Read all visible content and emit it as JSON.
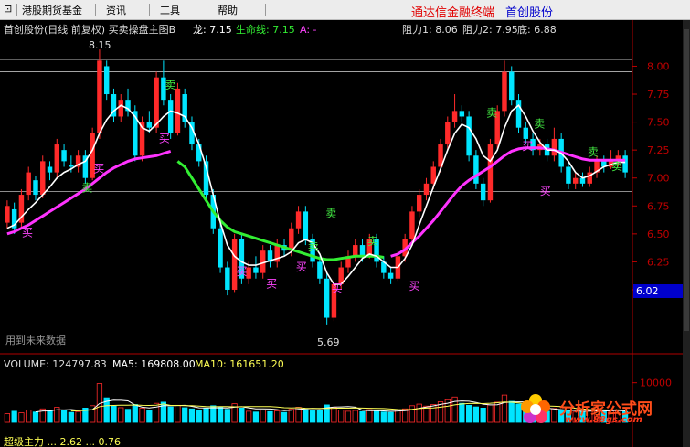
{
  "menu": {
    "items": [
      "港股期货基金",
      "资讯",
      "工具",
      "帮助"
    ],
    "app_title": "通达信金融终端",
    "stock_name": "首创股份"
  },
  "chart_header": {
    "title": "首创股份(日线 前复权) 买卖操盘主图B",
    "dragon_label": "龙: 7.15",
    "lifeline_label": "生命线: 7.15",
    "a_label": "A: -",
    "resistance1": "阻力1: 8.06",
    "resistance2": "阻力2: 7.95",
    "bottom": "底: 6.88"
  },
  "volume_header": {
    "volume": "VOLUME: 124797.83",
    "ma5": "MA5: 169808.00",
    "ma10": "MA10: 161651.20"
  },
  "notes": {
    "future_data": "用到未来数据",
    "peak_label": "8.15",
    "trough_label": "5.69",
    "current_price": "6.02",
    "bottom_row_partial": "超级主力 ... 2.62 ... 0.76"
  },
  "colors": {
    "up": "#ff2a2a",
    "down": "#00e5ff",
    "ma_white": "#ffffff",
    "ma_green": "#33ee33",
    "ma_magenta": "#ff33ff",
    "axis": "#c00000",
    "buy_label": "#ff44ff",
    "sell_label": "#44ee44"
  },
  "chart_data": {
    "type": "candlestick",
    "title": "首创股份(日线 前复权)",
    "ylim": [
      5.55,
      8.2
    ],
    "y_ticks": [
      8.0,
      7.75,
      7.5,
      7.25,
      7.0,
      6.75,
      6.5,
      6.25,
      6.0
    ],
    "resistance_lines": [
      8.06,
      7.95,
      6.88
    ],
    "candles": [
      [
        6.6,
        6.75,
        6.8,
        6.55
      ],
      [
        6.72,
        6.55,
        6.78,
        6.5
      ],
      [
        6.6,
        6.85,
        6.9,
        6.55
      ],
      [
        6.85,
        7.05,
        7.1,
        6.8
      ],
      [
        6.98,
        6.85,
        7.02,
        6.8
      ],
      [
        6.85,
        7.15,
        7.2,
        6.82
      ],
      [
        7.1,
        7.05,
        7.15,
        6.98
      ],
      [
        7.05,
        7.3,
        7.35,
        7.0
      ],
      [
        7.25,
        7.15,
        7.3,
        7.1
      ],
      [
        7.12,
        7.1,
        7.2,
        7.05
      ],
      [
        7.1,
        7.2,
        7.25,
        7.05
      ],
      [
        7.2,
        7.0,
        7.25,
        6.95
      ],
      [
        7.0,
        7.4,
        7.45,
        6.98
      ],
      [
        7.4,
        8.05,
        8.15,
        7.35
      ],
      [
        8.0,
        7.75,
        8.05,
        7.7
      ],
      [
        7.75,
        7.55,
        7.8,
        7.5
      ],
      [
        7.55,
        7.7,
        7.75,
        7.5
      ],
      [
        7.7,
        7.6,
        7.8,
        7.55
      ],
      [
        7.6,
        7.2,
        7.65,
        7.15
      ],
      [
        7.2,
        7.5,
        7.55,
        7.15
      ],
      [
        7.5,
        7.45,
        7.6,
        7.4
      ],
      [
        7.45,
        7.9,
        7.95,
        7.4
      ],
      [
        7.9,
        7.7,
        8.05,
        7.65
      ],
      [
        7.7,
        7.4,
        7.75,
        7.35
      ],
      [
        7.4,
        7.8,
        7.85,
        7.38
      ],
      [
        7.75,
        7.5,
        7.8,
        7.45
      ],
      [
        7.5,
        7.3,
        7.55,
        7.25
      ],
      [
        7.3,
        7.15,
        7.35,
        7.1
      ],
      [
        7.15,
        6.85,
        7.2,
        6.8
      ],
      [
        6.85,
        6.55,
        6.9,
        6.5
      ],
      [
        6.55,
        6.2,
        6.6,
        6.15
      ],
      [
        6.2,
        6.0,
        6.25,
        5.95
      ],
      [
        6.0,
        6.45,
        6.5,
        5.98
      ],
      [
        6.45,
        6.1,
        6.5,
        6.05
      ],
      [
        6.1,
        6.2,
        6.25,
        6.05
      ],
      [
        6.2,
        6.15,
        6.3,
        6.1
      ],
      [
        6.15,
        6.35,
        6.4,
        6.1
      ],
      [
        6.35,
        6.25,
        6.4,
        6.2
      ],
      [
        6.25,
        6.4,
        6.45,
        6.2
      ],
      [
        6.4,
        6.35,
        6.45,
        6.3
      ],
      [
        6.35,
        6.55,
        6.6,
        6.3
      ],
      [
        6.55,
        6.7,
        6.75,
        6.5
      ],
      [
        6.7,
        6.45,
        6.75,
        6.4
      ],
      [
        6.45,
        6.25,
        6.5,
        6.2
      ],
      [
        6.25,
        6.1,
        6.3,
        6.05
      ],
      [
        6.1,
        5.75,
        6.15,
        5.69
      ],
      [
        5.75,
        6.05,
        6.1,
        5.72
      ],
      [
        6.05,
        6.2,
        6.25,
        6.0
      ],
      [
        6.2,
        6.3,
        6.35,
        6.15
      ],
      [
        6.3,
        6.4,
        6.45,
        6.25
      ],
      [
        6.4,
        6.3,
        6.45,
        6.25
      ],
      [
        6.3,
        6.45,
        6.5,
        6.28
      ],
      [
        6.45,
        6.25,
        6.5,
        6.2
      ],
      [
        6.25,
        6.15,
        6.3,
        6.1
      ],
      [
        6.15,
        6.1,
        6.2,
        6.05
      ],
      [
        6.1,
        6.3,
        6.35,
        6.08
      ],
      [
        6.3,
        6.45,
        6.5,
        6.25
      ],
      [
        6.45,
        6.7,
        6.75,
        6.4
      ],
      [
        6.7,
        6.85,
        6.9,
        6.65
      ],
      [
        6.85,
        6.95,
        7.0,
        6.8
      ],
      [
        6.95,
        7.1,
        7.15,
        6.9
      ],
      [
        7.1,
        7.3,
        7.35,
        7.05
      ],
      [
        7.3,
        7.5,
        7.55,
        7.25
      ],
      [
        7.5,
        7.6,
        7.75,
        7.45
      ],
      [
        7.6,
        7.55,
        7.65,
        7.5
      ],
      [
        7.55,
        7.2,
        7.6,
        7.15
      ],
      [
        7.2,
        6.95,
        7.25,
        6.9
      ],
      [
        6.95,
        6.8,
        7.0,
        6.75
      ],
      [
        6.8,
        7.3,
        7.35,
        6.78
      ],
      [
        7.3,
        7.6,
        7.65,
        7.25
      ],
      [
        7.6,
        7.95,
        8.05,
        7.55
      ],
      [
        7.95,
        7.7,
        8.0,
        7.65
      ],
      [
        7.7,
        7.45,
        7.75,
        7.4
      ],
      [
        7.45,
        7.35,
        7.5,
        7.3
      ],
      [
        7.35,
        7.25,
        7.4,
        7.2
      ],
      [
        7.25,
        7.3,
        7.35,
        7.2
      ],
      [
        7.3,
        7.2,
        7.35,
        7.15
      ],
      [
        7.2,
        7.35,
        7.45,
        7.15
      ],
      [
        7.35,
        7.1,
        7.4,
        7.05
      ],
      [
        7.1,
        6.95,
        7.15,
        6.9
      ],
      [
        6.95,
        7.0,
        7.05,
        6.9
      ],
      [
        7.0,
        6.95,
        7.05,
        6.92
      ],
      [
        6.95,
        7.05,
        7.1,
        6.92
      ],
      [
        7.05,
        7.15,
        7.2,
        7.0
      ],
      [
        7.15,
        7.1,
        7.2,
        7.05
      ],
      [
        7.1,
        7.15,
        7.25,
        7.08
      ],
      [
        7.15,
        7.2,
        7.25,
        7.1
      ],
      [
        7.2,
        7.05,
        7.25,
        7.0
      ]
    ],
    "ma_white": [
      6.55,
      6.58,
      6.65,
      6.72,
      6.78,
      6.85,
      6.92,
      7.0,
      7.05,
      7.08,
      7.12,
      7.15,
      7.25,
      7.4,
      7.52,
      7.6,
      7.65,
      7.62,
      7.55,
      7.45,
      7.42,
      7.48,
      7.55,
      7.6,
      7.58,
      7.55,
      7.45,
      7.3,
      7.1,
      6.85,
      6.6,
      6.4,
      6.3,
      6.25,
      6.22,
      6.22,
      6.24,
      6.26,
      6.28,
      6.3,
      6.34,
      6.42,
      6.45,
      6.42,
      6.32,
      6.15,
      6.05,
      6.05,
      6.12,
      6.2,
      6.28,
      6.32,
      6.3,
      6.25,
      6.2,
      6.2,
      6.28,
      6.4,
      6.58,
      6.75,
      6.92,
      7.08,
      7.25,
      7.4,
      7.48,
      7.45,
      7.35,
      7.2,
      7.15,
      7.25,
      7.45,
      7.6,
      7.65,
      7.55,
      7.42,
      7.32,
      7.25,
      7.25,
      7.22,
      7.15,
      7.05,
      7.0,
      7.02,
      7.06,
      7.1,
      7.12,
      7.14,
      7.14
    ],
    "ma_green": [
      null,
      null,
      null,
      null,
      null,
      null,
      null,
      null,
      null,
      null,
      null,
      null,
      null,
      null,
      null,
      null,
      null,
      null,
      null,
      null,
      null,
      null,
      null,
      null,
      7.15,
      7.1,
      7.0,
      6.9,
      6.8,
      6.7,
      6.62,
      6.56,
      6.52,
      6.5,
      6.48,
      6.46,
      6.44,
      6.42,
      6.4,
      6.38,
      6.36,
      6.34,
      6.32,
      6.3,
      6.28,
      6.27,
      6.27,
      6.28,
      6.29,
      6.3,
      6.3,
      6.3,
      6.3,
      6.29
    ],
    "ma_magenta": [
      6.5,
      6.52,
      6.55,
      6.58,
      6.62,
      6.66,
      6.7,
      6.74,
      6.78,
      6.82,
      6.86,
      6.9,
      6.95,
      7.0,
      7.05,
      7.09,
      7.12,
      7.15,
      7.17,
      7.18,
      7.19,
      7.2,
      7.22,
      7.24,
      null,
      null,
      null,
      null,
      null,
      null,
      null,
      null,
      null,
      null,
      null,
      null,
      null,
      null,
      null,
      null,
      null,
      null,
      null,
      null,
      null,
      null,
      null,
      null,
      null,
      null,
      null,
      null,
      null,
      null,
      6.3,
      6.32,
      6.36,
      6.42,
      6.48,
      6.55,
      6.62,
      6.7,
      6.78,
      6.86,
      6.93,
      6.98,
      7.02,
      7.06,
      7.1,
      7.15,
      7.2,
      7.24,
      7.26,
      7.27,
      7.27,
      7.27,
      7.26,
      7.25,
      7.23,
      7.21,
      7.19,
      7.17,
      7.16,
      7.16,
      7.16,
      7.16,
      7.16,
      7.16
    ],
    "buy_marks": [
      [
        4,
        6.48
      ],
      [
        16,
        7.05
      ],
      [
        27,
        7.32
      ],
      [
        40,
        6.13
      ],
      [
        45,
        6.02
      ],
      [
        50,
        6.17
      ],
      [
        56,
        5.98
      ],
      [
        69,
        6.0
      ],
      [
        88,
        7.25
      ],
      [
        91,
        6.85
      ]
    ],
    "sell_marks": [
      [
        14,
        6.88
      ],
      [
        28,
        7.8
      ],
      [
        52,
        6.35
      ],
      [
        55,
        6.65
      ],
      [
        62,
        6.4
      ],
      [
        82,
        7.55
      ],
      [
        90,
        7.45
      ],
      [
        99,
        7.2
      ],
      [
        103,
        7.07
      ]
    ],
    "volume": {
      "ylim": [
        0,
        12000
      ],
      "y_ticks": [
        10000
      ],
      "values": [
        2200,
        2800,
        2400,
        3100,
        2600,
        3400,
        2900,
        3800,
        3000,
        2500,
        2700,
        3600,
        4200,
        9800,
        6200,
        4100,
        3700,
        3300,
        4500,
        3600,
        3100,
        4800,
        5100,
        3900,
        4300,
        3700,
        3400,
        3100,
        3600,
        4200,
        3900,
        3300,
        4700,
        3600,
        2800,
        2600,
        3100,
        2700,
        2900,
        2500,
        3300,
        3800,
        3200,
        2900,
        3000,
        4400,
        3800,
        3100,
        2800,
        3000,
        2700,
        3200,
        2900,
        2600,
        2500,
        3100,
        3400,
        4200,
        4600,
        4100,
        4500,
        5200,
        5700,
        6400,
        4800,
        4300,
        3900,
        3600,
        4400,
        5100,
        6900,
        5300,
        4600,
        3900,
        3400,
        3200,
        2800,
        3500,
        3100,
        2900,
        2600,
        2700,
        2900,
        3300,
        2800,
        2900,
        3000,
        2700
      ],
      "ma5": [
        null,
        null,
        null,
        null,
        2620,
        2860,
        2880,
        3160,
        3140,
        3240,
        3040,
        3120,
        3200,
        4760,
        5300,
        5580,
        5560,
        5420,
        4360,
        3840,
        3640,
        3860,
        4220,
        4200,
        4240,
        4300,
        4040,
        3680,
        3620,
        3660,
        3660,
        3620,
        3840,
        3940,
        3660,
        3400,
        3400,
        3360,
        3200,
        2960,
        3040,
        3280,
        3420,
        3540,
        3440,
        3660,
        3860,
        3900,
        3980,
        3820,
        3080,
        2960,
        2920,
        2880,
        2780,
        2860,
        2940,
        3160,
        3560,
        3880,
        4160,
        4520,
        4820,
        5280,
        5400,
        5320,
        5020,
        4600,
        4400,
        4460,
        4980,
        5120,
        5160,
        5160,
        4820,
        4180,
        3580,
        3360,
        3200,
        3060,
        2980,
        2760,
        2820,
        2880,
        2860,
        2920,
        3000,
        2880
      ],
      "ma10": [
        null,
        null,
        null,
        null,
        null,
        null,
        null,
        null,
        null,
        2870,
        2900,
        3000,
        3180,
        3960,
        4220,
        4260,
        4340,
        4310,
        4390,
        4300,
        4280,
        4340,
        4640,
        4280,
        4270,
        4230,
        4200,
        4080,
        3960,
        3940,
        3990,
        3980,
        3930,
        3950,
        3980,
        3960,
        3980,
        3960,
        3880,
        3700,
        3620,
        3690,
        3560,
        3520,
        3540,
        3540,
        3560,
        3590,
        3580,
        3640,
        3610,
        3550,
        3520,
        3490,
        3360,
        3230,
        3190,
        3300,
        3480,
        3590,
        3630,
        3830,
        4060,
        4400,
        4630,
        4750,
        4800,
        4740,
        4820,
        4960,
        5150,
        5070,
        4900,
        4670,
        4470,
        4250,
        4140,
        4060,
        3980,
        3800,
        3550,
        3360,
        3230,
        3180,
        3130,
        3110,
        3130,
        3090
      ]
    }
  }
}
